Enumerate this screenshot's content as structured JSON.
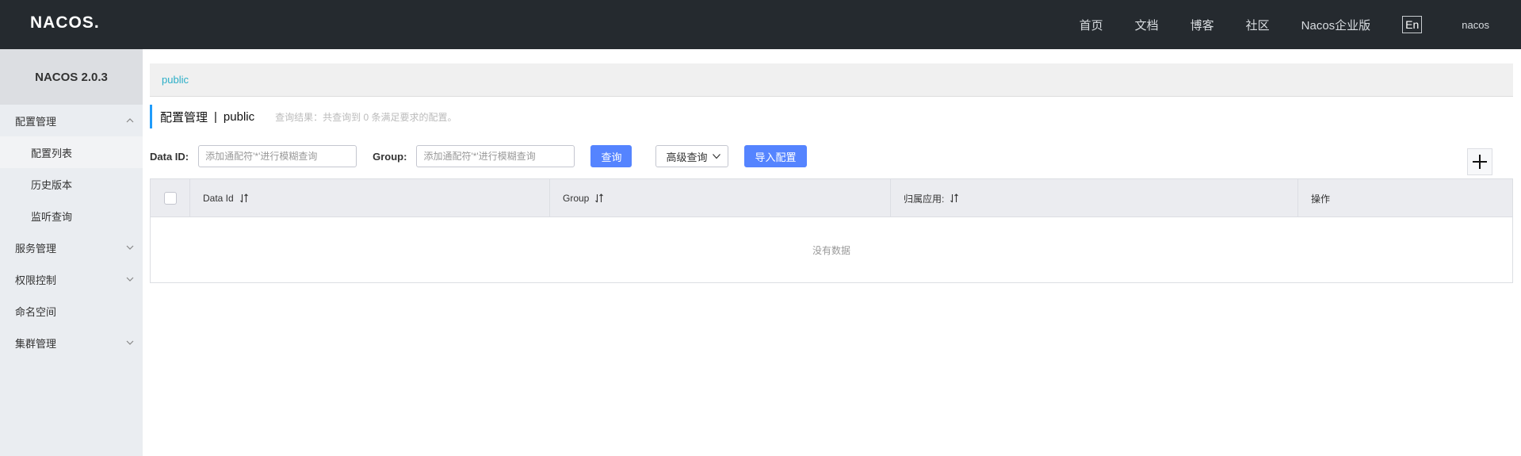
{
  "header": {
    "logo_text": "NACOS.",
    "nav": [
      "首页",
      "文档",
      "博客",
      "社区",
      "Nacos企业版"
    ],
    "lang_button": "En",
    "user": "nacos"
  },
  "sidebar": {
    "version": "NACOS 2.0.3",
    "items": [
      {
        "label": "配置管理",
        "level": 1,
        "expanded": true
      },
      {
        "label": "配置列表",
        "level": 2,
        "active": true
      },
      {
        "label": "历史版本",
        "level": 2
      },
      {
        "label": "监听查询",
        "level": 2
      },
      {
        "label": "服务管理",
        "level": 1,
        "expanded": false
      },
      {
        "label": "权限控制",
        "level": 1,
        "expanded": false
      },
      {
        "label": "命名空间",
        "level": 1
      },
      {
        "label": "集群管理",
        "level": 1,
        "expanded": false
      }
    ]
  },
  "namespace_bar": {
    "selected": "public"
  },
  "page": {
    "title": "配置管理",
    "separator": "|",
    "namespace": "public",
    "result_text": "查询结果：共查询到 0 条满足要求的配置。"
  },
  "filters": {
    "data_id_label": "Data ID:",
    "data_id_placeholder": "添加通配符'*'进行模糊查询",
    "group_label": "Group:",
    "group_placeholder": "添加通配符'*'进行模糊查询",
    "search_button": "查询",
    "advanced_button": "高级查询",
    "import_button": "导入配置"
  },
  "table": {
    "columns": [
      "Data Id",
      "Group",
      "归属应用:",
      "操作"
    ],
    "empty_text": "没有数据"
  },
  "colors": {
    "topbar": "#252a2f",
    "primary": "#5584ff",
    "accent": "#209bfa",
    "link": "#2aaec7"
  }
}
